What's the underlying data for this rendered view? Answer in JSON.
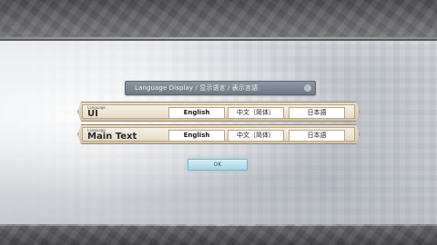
{
  "dialog": {
    "title": "Language Display / 显示语言 / 表示言語"
  },
  "rows": [
    {
      "caption": "Language",
      "name": "UI",
      "options": [
        "English",
        "中文（简体）",
        "日本語"
      ],
      "selected": "English"
    },
    {
      "caption": "Language",
      "name": "Main Text",
      "options": [
        "English",
        "中文（简体）",
        "日本語"
      ],
      "selected": "English"
    }
  ],
  "ok_label": "OK",
  "colors": {
    "title_bar": "#7f8893",
    "row_frame": "#d6c6aa",
    "ok_button": "#bfe1ee"
  }
}
